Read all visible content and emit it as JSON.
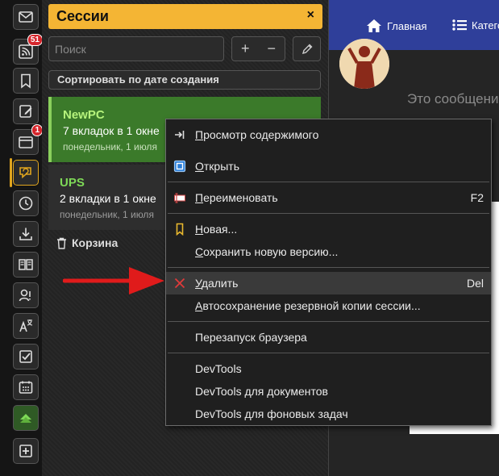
{
  "iconbar": {
    "items": [
      {
        "name": "mail-icon",
        "badge": ""
      },
      {
        "name": "rss-icon",
        "badge": "51"
      },
      {
        "name": "bookmark-icon",
        "badge": ""
      },
      {
        "name": "notes-icon",
        "badge": ""
      },
      {
        "name": "window-icon",
        "badge": "1"
      },
      {
        "name": "sessions-icon",
        "badge": ""
      },
      {
        "name": "history-icon",
        "badge": ""
      },
      {
        "name": "downloads-icon",
        "badge": ""
      },
      {
        "name": "reader-icon",
        "badge": ""
      },
      {
        "name": "contacts-icon",
        "badge": ""
      },
      {
        "name": "translate-icon",
        "badge": ""
      },
      {
        "name": "tasks-icon",
        "badge": ""
      },
      {
        "name": "calendar-icon",
        "badge": ""
      },
      {
        "name": "feed-up-icon",
        "badge": ""
      },
      {
        "name": "add-panel-icon",
        "badge": ""
      }
    ],
    "accent": "#e0a51e"
  },
  "panel": {
    "title": "Сессии",
    "close": "×",
    "search_placeholder": "Поиск",
    "plus": "+",
    "minus": "−",
    "sort_label": "Сортировать по дате создания",
    "sessions": [
      {
        "name": "NewPC",
        "tabs": "7 вкладок в 1 окне",
        "date": "понедельник, 1 июля"
      },
      {
        "name": "UPS",
        "tabs": "2 вкладки в 1 окне",
        "date": "понедельник, 1 июля"
      }
    ],
    "trash_label": "Корзина",
    "header_color": "#f4b534"
  },
  "browser": {
    "nav": [
      {
        "label": "Главная",
        "icon": "home-icon"
      },
      {
        "label": "Категории",
        "icon": "list-icon"
      }
    ],
    "ghost_text": "Это сообщение",
    "nav_color": "#2f3f9a"
  },
  "context_menu": {
    "items": [
      {
        "pre": "",
        "u": "П",
        "post": "росмотр содержимого",
        "shortcut": "",
        "icon": "open-content-icon"
      },
      {
        "pre": "",
        "u": "О",
        "post": "ткрыть",
        "shortcut": "",
        "icon": "open-window-icon"
      },
      {
        "pre": "",
        "u": "П",
        "post": "ереименовать",
        "shortcut": "F2",
        "icon": "rename-icon"
      },
      {
        "pre": "",
        "u": "Н",
        "post": "овая...",
        "shortcut": "",
        "icon": "new-bookmark-icon"
      },
      {
        "pre": "",
        "u": "С",
        "post": "охранить новую версию...",
        "shortcut": "",
        "icon": ""
      },
      {
        "pre": "",
        "u": "У",
        "post": "далить",
        "shortcut": "Del",
        "icon": "delete-icon"
      },
      {
        "pre": "",
        "u": "А",
        "post": "втосохранение резервной копии сессии...",
        "shortcut": "",
        "icon": ""
      },
      {
        "pre": "Перезапуск браузера",
        "u": "",
        "post": "",
        "shortcut": "",
        "icon": ""
      },
      {
        "pre": "DevTools",
        "u": "",
        "post": "",
        "shortcut": "",
        "icon": ""
      },
      {
        "pre": "DevTools для документов",
        "u": "",
        "post": "",
        "shortcut": "",
        "icon": ""
      },
      {
        "pre": "DevTools для фоновых задач",
        "u": "",
        "post": "",
        "shortcut": "",
        "icon": ""
      }
    ],
    "highlighted_index": 5,
    "delete_color": "#e03a3a"
  },
  "annotation": {
    "arrow_color": "#e01b1b"
  }
}
